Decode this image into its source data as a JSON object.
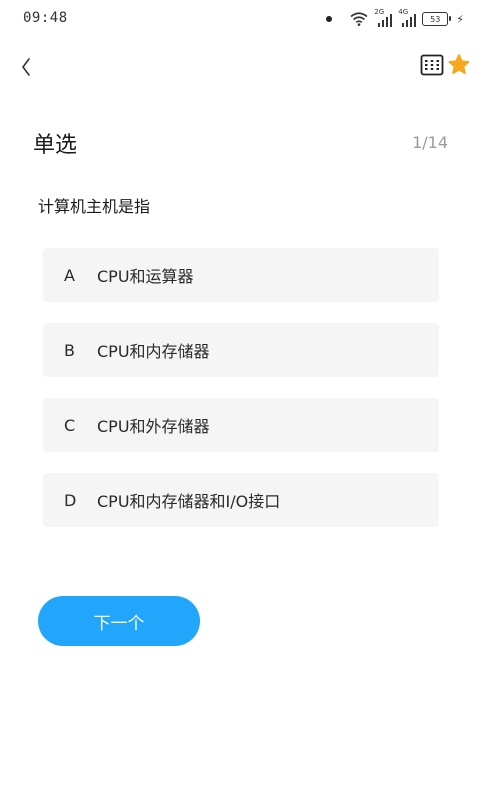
{
  "status_bar": {
    "time": "09:48",
    "net1": "2G",
    "net2": "4G",
    "battery": "53"
  },
  "nav": {
    "back_icon": "chevron-left-icon",
    "sheet_icon": "answer-sheet-icon",
    "favorite_icon": "star-icon"
  },
  "question": {
    "type": "单选",
    "progress": "1/14",
    "text": "计算机主机是指"
  },
  "options": [
    {
      "letter": "A",
      "text": "CPU和运算器"
    },
    {
      "letter": "B",
      "text": "CPU和内存储器"
    },
    {
      "letter": "C",
      "text": "CPU和外存储器"
    },
    {
      "letter": "D",
      "text": "CPU和内存储器和I/O接口"
    }
  ],
  "next_button": {
    "label": "下一个"
  },
  "colors": {
    "accent": "#21a6fb",
    "star": "#f7a71c",
    "option_bg": "#f5f5f5"
  }
}
